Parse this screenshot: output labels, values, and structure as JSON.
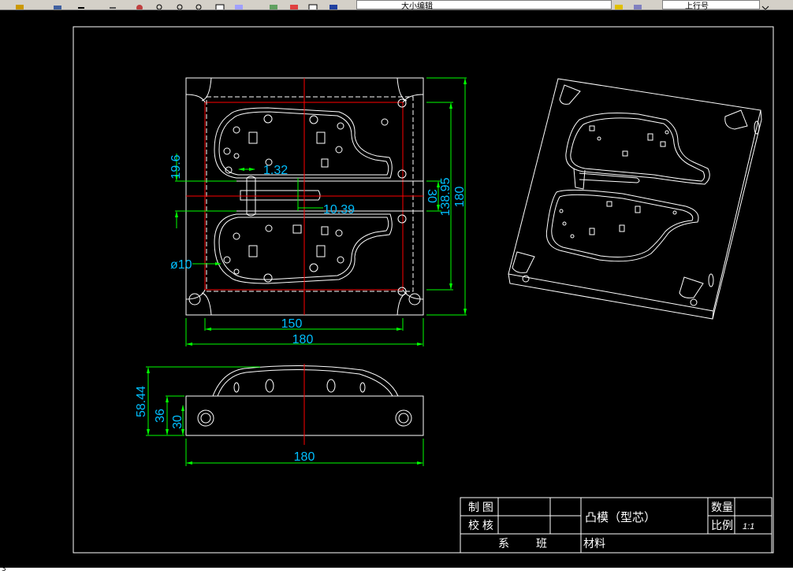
{
  "toolbar": {
    "layer_name": "大小编辑",
    "style_name": "上行号",
    "icons": [
      "save-icon",
      "print-icon",
      "undo-icon",
      "redo-icon",
      "pan-icon",
      "zoom-realtime-icon",
      "zoom-window-icon",
      "zoom-previous-icon",
      "properties-icon",
      "design-center-icon",
      "tool-palette-icon",
      "layer-icon",
      "help-icon",
      "layer-state-icon",
      "color-icon",
      "linetype-icon"
    ]
  },
  "drawing": {
    "dimensions": {
      "top_d196": "19.6",
      "top_d132": "1.32",
      "top_d1039": "10.39",
      "top_dia10": "ø10",
      "top_d30": "30",
      "top_d13895": "138.95",
      "top_d180v": "180",
      "top_d150": "150",
      "top_d180h": "180",
      "side_d5844": "58.44",
      "side_d36": "36",
      "side_d30": "30",
      "side_d180": "180"
    },
    "title_block": {
      "made_by": "制 图",
      "checked_by": "校 核",
      "part_name": "凸模（型芯）",
      "quantity_label": "数量",
      "scale_label": "比例",
      "scale_value": "1:1",
      "department_label": "系",
      "class_label": "班",
      "material_label": "材料"
    }
  },
  "status": {
    "coords": "3"
  },
  "colors": {
    "background": "#000000",
    "lines": "#ffffff",
    "centerline": "#ff0000",
    "dimension": "#00ff00",
    "dim_text": "#00bfff"
  }
}
